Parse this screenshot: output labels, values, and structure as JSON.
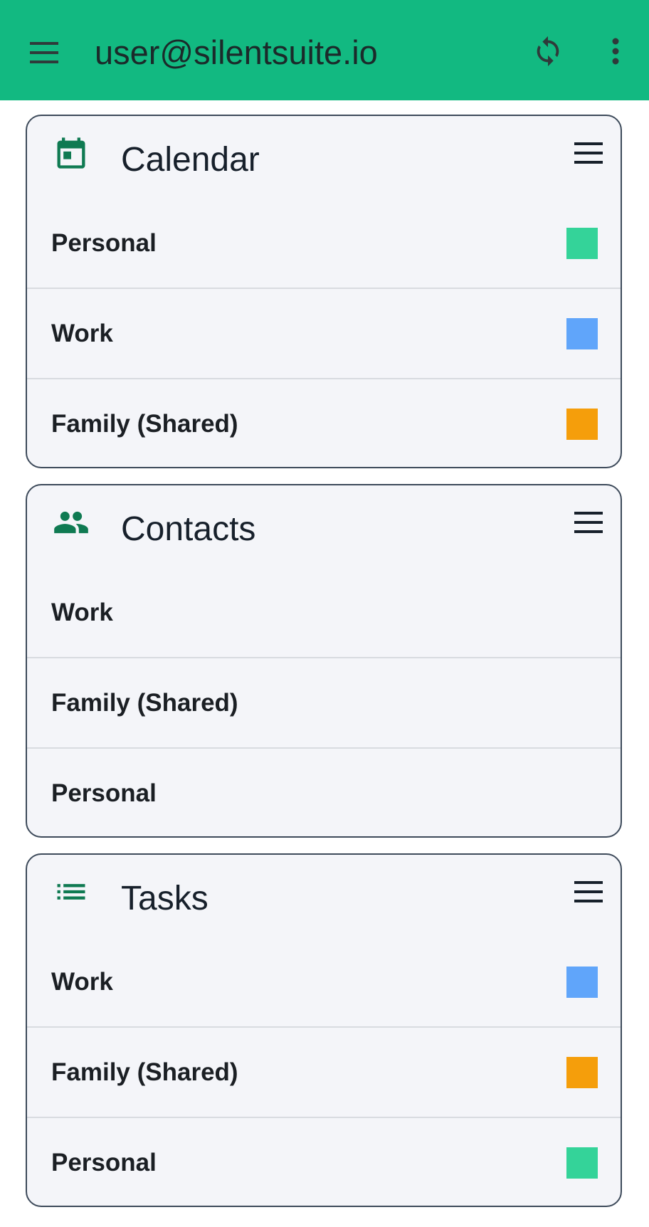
{
  "appbar": {
    "title": "user@silentsuite.io",
    "background": "#12b981",
    "menu_icon": "hamburger-icon",
    "sync_icon": "sync-icon",
    "more_icon": "more-vert-icon"
  },
  "colors": {
    "personal": "#34d399",
    "work": "#60a5fa",
    "family": "#f59e0b",
    "icon_green": "#0f7a52"
  },
  "sections": [
    {
      "title": "Calendar",
      "icon": "calendar-icon",
      "items": [
        {
          "label": "Personal",
          "color": "#34d399"
        },
        {
          "label": "Work",
          "color": "#60a5fa"
        },
        {
          "label": "Family (Shared)",
          "color": "#f59e0b"
        }
      ]
    },
    {
      "title": "Contacts",
      "icon": "people-icon",
      "items": [
        {
          "label": "Work"
        },
        {
          "label": "Family (Shared)"
        },
        {
          "label": "Personal"
        }
      ]
    },
    {
      "title": "Tasks",
      "icon": "list-icon",
      "items": [
        {
          "label": "Work",
          "color": "#60a5fa"
        },
        {
          "label": "Family (Shared)",
          "color": "#f59e0b"
        },
        {
          "label": "Personal",
          "color": "#34d399"
        }
      ]
    }
  ]
}
